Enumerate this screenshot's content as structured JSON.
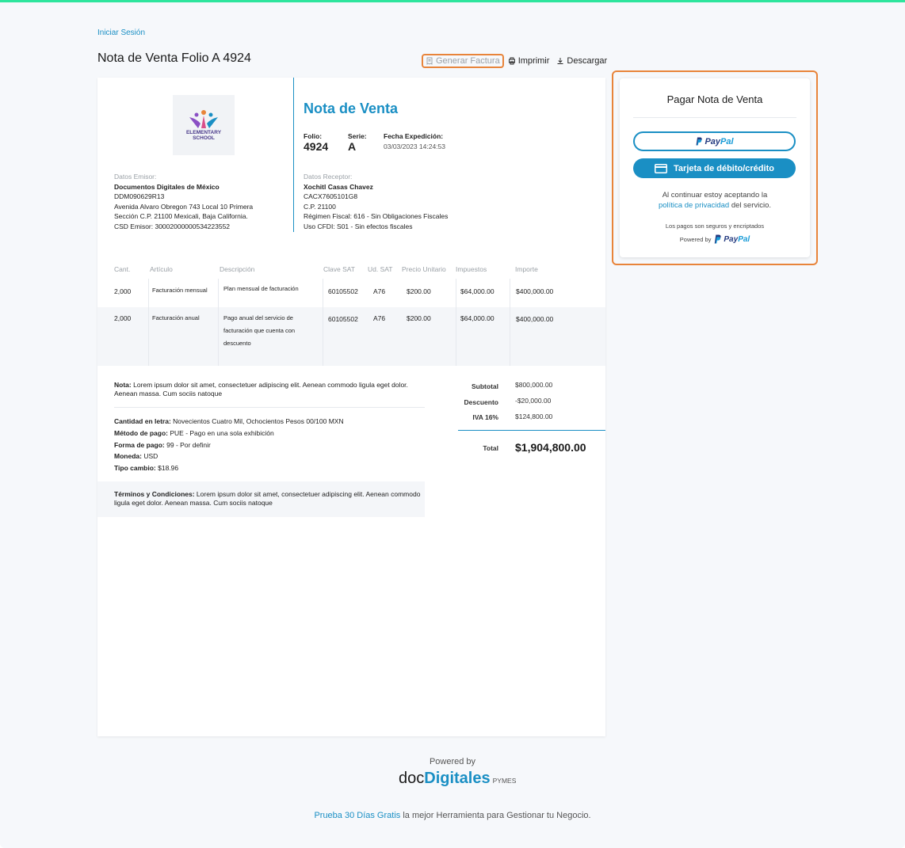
{
  "header": {
    "login": "Iniciar Sesión",
    "title": "Nota de Venta Folio A 4924",
    "actions": {
      "generar": "Generar Factura",
      "imprimir": "Imprimir",
      "descargar": "Descargar"
    }
  },
  "document": {
    "logo": {
      "line1": "ELEMENTARY",
      "line2": "SCHOOL"
    },
    "title": "Nota de Venta",
    "folio": {
      "label": "Folio:",
      "value": "4924"
    },
    "serie": {
      "label": "Serie:",
      "value": "A"
    },
    "fecha": {
      "label": "Fecha Expedición:",
      "value": "03/03/2023 14:24:53"
    },
    "emisor": {
      "label": "Datos Emisor:",
      "name": "Documentos Digitales de México",
      "rfc": "DDM090629R13",
      "address1": "Avenida Alvaro Obregon 743 Local 10 Primera",
      "address2": "Sección C.P. 21100 Mexicali, Baja California.",
      "csd": "CSD Emisor: 30002000000534223552"
    },
    "receptor": {
      "label": "Datos Receptor:",
      "name": "Xochitl Casas Chavez",
      "rfc": "CACX7605101G8",
      "cp": "C.P. 21100",
      "regimen": "Régimen Fiscal: 616 - Sin Obligaciones Fiscales",
      "uso": "Uso CFDI: S01 - Sin efectos fiscales"
    },
    "table": {
      "headers": [
        "Cant.",
        "Artículo",
        "Descripción",
        "Clave SAT",
        "Ud. SAT",
        "Precio Unitario",
        "Impuestos",
        "Importe"
      ],
      "rows": [
        {
          "cant": "2,000",
          "articulo": "Facturación mensual",
          "descripcion": "Plan mensual de facturación",
          "clave": "60105502",
          "ud": "A76",
          "precio": "$200.00",
          "impuestos": "$64,000.00",
          "importe": "$400,000.00"
        },
        {
          "cant": "2,000",
          "articulo": "Facturación anual",
          "descripcion": "Pago anual del servicio de facturación que cuenta con descuento",
          "clave": "60105502",
          "ud": "A76",
          "precio": "$200.00",
          "impuestos": "$64,000.00",
          "importe": "$400,000.00"
        }
      ]
    },
    "nota": {
      "label": "Nota:",
      "text": " Lorem ipsum dolor sit amet, consectetuer adipiscing elit. Aenean commodo ligula eget dolor. Aenean massa. Cum sociis natoque"
    },
    "extra": {
      "cantidad_label": "Cantidad en letra:",
      "cantidad": " Novecientos Cuatro Mil, Ochocientos Pesos 00/100 MXN",
      "metodo_label": "Método de pago:",
      "metodo": " PUE - Pago en una sola exhibición",
      "forma_label": "Forma de pago:",
      "forma": " 99 - Por definir",
      "moneda_label": "Moneda:",
      "moneda": " USD",
      "tipo_label": "Tipo cambio:",
      "tipo": " $18.96"
    },
    "terms": {
      "label": "Términos y Condiciones:",
      "text": " Lorem ipsum dolor sit amet, consectetuer adipiscing elit. Aenean commodo ligula eget dolor. Aenean massa. Cum sociis natoque"
    },
    "totals": {
      "subtotal_label": "Subtotal",
      "subtotal": "$800,000.00",
      "descuento_label": "Descuento",
      "descuento": "-$20,000.00",
      "iva_label": "IVA 16%",
      "iva": "$124,800.00",
      "total_label": "Total",
      "total": "$1,904,800.00"
    }
  },
  "payment": {
    "title": "Pagar Nota de Venta",
    "paypal_pay": "Pay",
    "paypal_pal": "Pal",
    "card_label": "Tarjeta de débito/crédito",
    "consent_pre": "Al continuar estoy aceptando la",
    "consent_link": "política de privacidad",
    "consent_post": " del servicio.",
    "secure": "Los pagos son seguros y encriptados",
    "powered_by": "Powered by"
  },
  "footer": {
    "powered": "Powered by",
    "brand_doc": "doc",
    "brand_dig": "Digitales",
    "brand_py": "PYMES",
    "cta_link": "Prueba 30 Días Gratis",
    "cta_text": " la mejor Herramienta para Gestionar tu Negocio."
  },
  "colors": {
    "accent": "#1a8fc4",
    "highlight": "#e8843a",
    "top_bar": "#2ee59d"
  }
}
